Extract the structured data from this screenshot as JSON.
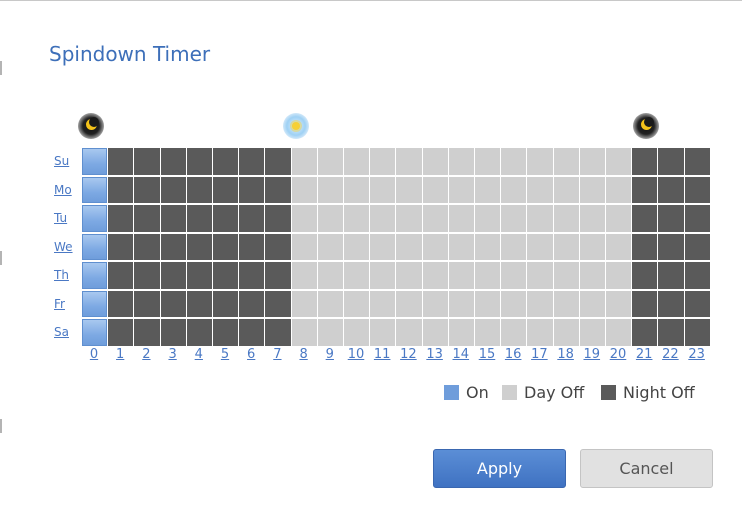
{
  "dialog": {
    "title": "Spindown Timer"
  },
  "icons": {
    "night_start": "moon-icon",
    "day_start": "sun-icon",
    "night_end": "moon-icon"
  },
  "days": [
    "Su",
    "Mo",
    "Tu",
    "We",
    "Th",
    "Fr",
    "Sa"
  ],
  "hours": [
    "0",
    "1",
    "2",
    "3",
    "4",
    "5",
    "6",
    "7",
    "8",
    "9",
    "10",
    "11",
    "12",
    "13",
    "14",
    "15",
    "16",
    "17",
    "18",
    "19",
    "20",
    "21",
    "22",
    "23"
  ],
  "schedule": {
    "on_hours": [
      0
    ],
    "night_off_hours": [
      1,
      2,
      3,
      4,
      5,
      6,
      7,
      21,
      22,
      23
    ],
    "day_off_hours": [
      8,
      9,
      10,
      11,
      12,
      13,
      14,
      15,
      16,
      17,
      18,
      19,
      20
    ]
  },
  "legend": {
    "on_label": "On",
    "day_off_label": "Day Off",
    "night_off_label": "Night Off",
    "on_color": "#6f9ddb",
    "day_off_color": "#cfcfcf",
    "night_off_color": "#5a5a5a"
  },
  "buttons": {
    "apply_label": "Apply",
    "cancel_label": "Cancel"
  }
}
